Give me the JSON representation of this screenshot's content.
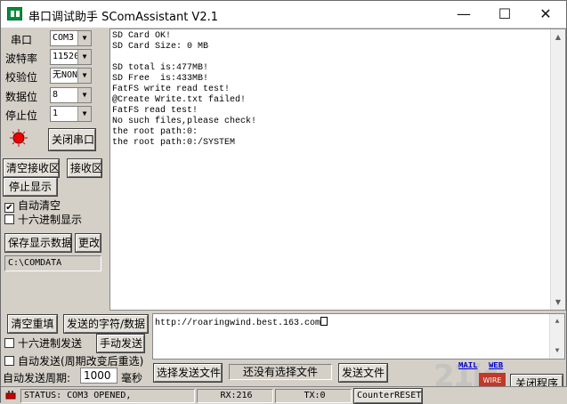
{
  "window": {
    "title": "串口调试助手 SComAssistant V2.1",
    "min": "—",
    "max": "☐",
    "close": "✕"
  },
  "settings": {
    "port_label": "串口",
    "port_value": "COM3",
    "baud_label": "波特率",
    "baud_value": "11520",
    "parity_label": "校验位",
    "parity_value": "无NON",
    "databits_label": "数据位",
    "databits_value": "8",
    "stopbits_label": "停止位",
    "stopbits_value": "1",
    "close_port_button": "关闭串口"
  },
  "receive_controls": {
    "clear_recv_button": "清空接收区",
    "recv_area_button": "接收区",
    "stop_display_button": "停止显示",
    "auto_clear_label": "自动清空",
    "auto_clear_checked": true,
    "hex_display_label": "十六进制显示",
    "hex_display_checked": false,
    "save_data_button": "保存显示数据",
    "change_button": "更改",
    "save_path": "C:\\COMDATA"
  },
  "receive_text": "SD Card OK!\nSD Card Size: 0 MB\n\nSD total is:477MB!\nSD Free  is:433MB!\nFatFS write read test!\n@Create Write.txt failed!\nFatFS read test!\nNo such files,please check!\nthe root path:0:\nthe root path:0:/SYSTEM",
  "send_controls": {
    "clear_resend_button": "清空重填",
    "send_chars_button": "发送的字符/数据",
    "hex_send_label": "十六进制发送",
    "manual_send_button": "手动发送",
    "auto_send_label": "自动发送(周期改变后重选)",
    "period_label": "自动发送周期:",
    "period_value": "1000",
    "period_unit": "毫秒",
    "select_file_button": "选择发送文件",
    "no_file_text": "还没有选择文件",
    "send_file_button": "发送文件",
    "send_text": "http://roaringwind.best.163.com"
  },
  "status_bar": {
    "status": "STATUS: COM3 OPENED,",
    "rx": "RX:216",
    "tx": "TX:0",
    "counter_reset": "CounterRESET"
  },
  "links": {
    "mail": "MAIL",
    "web": "WEB"
  },
  "exit_button": "关闭程序",
  "watermark": "21ic",
  "logo_text": "WIRE\nSTUDIO"
}
